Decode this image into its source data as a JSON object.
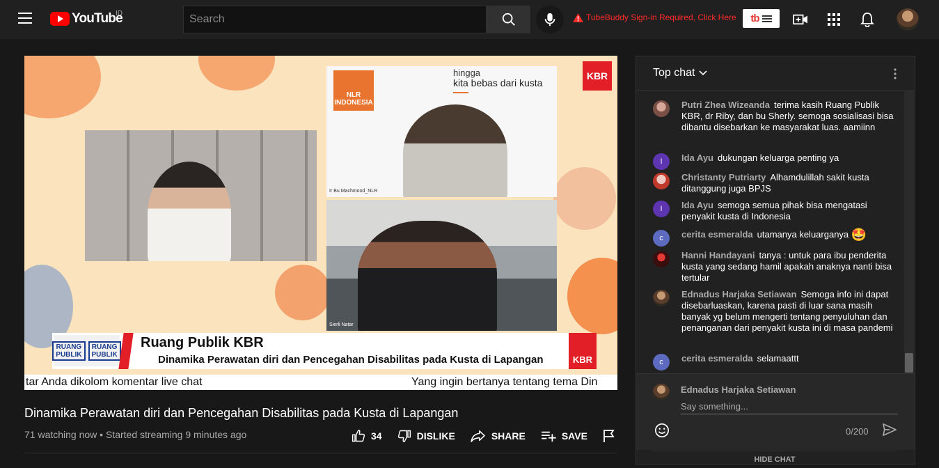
{
  "header": {
    "logo_text": "YouTube",
    "region": "ID",
    "search_placeholder": "Search",
    "tubebuddy_warning": "TubeBuddy Sign-in Required, Click Here",
    "tubebuddy_logo": "tb"
  },
  "video": {
    "nlr_label": "NLR INDONESIA",
    "slogan_line1": "hingga",
    "slogan_line2": "kita bebas dari kusta",
    "top_panel_tag": "Ir Bu Machmood_NLR",
    "bottom_panel_tag": "Sierli Natar",
    "kbr_logo": "KBR",
    "lower_third_logo": "RUANG PUBLIK",
    "lower_third_title": "Ruang Publik KBR",
    "lower_third_subtitle": "Dinamika Perawatan diri dan Pencegahan Disabilitas pada Kusta di Lapangan",
    "ticker_left": "tar Anda dikolom komentar live chat",
    "ticker_right": "Yang ingin bertanya tentang tema Din"
  },
  "info": {
    "title": "Dinamika Perawatan diri dan Pencegahan Disabilitas pada Kusta di Lapangan",
    "meta": "71 watching now • Started streaming 9 minutes ago",
    "likes": "34",
    "dislike_label": "DISLIKE",
    "share_label": "SHARE",
    "save_label": "SAVE"
  },
  "chat": {
    "header_label": "Top chat",
    "messages": [
      {
        "author": "Putri Zhea Wizeanda",
        "text": "terima kasih Ruang Publik KBR, dr Riby, dan bu Sherly. semoga sosialisasi bisa dibantu disebarkan ke masyarakat luas. aamiinn",
        "initial": ""
      },
      {
        "author": "Ida Ayu",
        "text": "dukungan keluarga penting ya",
        "initial": "I"
      },
      {
        "author": "Christanty Putriarty",
        "text": "Alhamdulillah sakit kusta ditanggung juga BPJS",
        "initial": ""
      },
      {
        "author": "Ida Ayu",
        "text": "semoga semua pihak bisa mengatasi penyakit kusta di Indonesia",
        "initial": "I"
      },
      {
        "author": "cerita esmeralda",
        "text": "utamanya keluarganya",
        "initial": "c",
        "emoji": "🤩"
      },
      {
        "author": "Hanni Handayani",
        "text": "tanya : untuk para ibu penderita kusta yang sedang hamil apakah anaknya nanti bisa tertular",
        "initial": ""
      },
      {
        "author": "Ednadus Harjaka Setiawan",
        "text": "Semoga info ini dapat disebarluaskan, karena pasti di luar sana masih banyak yg belum mengerti tentang penyuluhan dan penanganan dari penyakit kusta ini di masa pandemi",
        "initial": ""
      },
      {
        "author": "cerita esmeralda",
        "text": "selamaattt",
        "initial": "c"
      }
    ],
    "composer_name": "Ednadus Harjaka Setiawan",
    "composer_placeholder": "Say something...",
    "char_count": "0/200",
    "hide_chat": "HIDE CHAT"
  },
  "colors": {
    "accent_red": "#ff0000",
    "avatar_purple": "#5e35b1",
    "avatar_indigo": "#5c6bc0"
  }
}
